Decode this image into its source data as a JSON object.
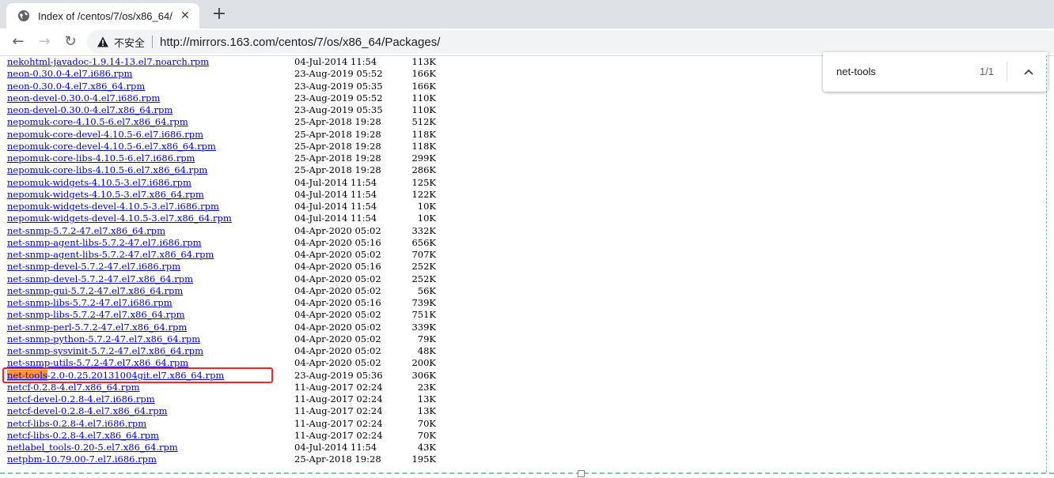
{
  "browser": {
    "tab_title": "Index of /centos/7/os/x86_64/",
    "tab_close": "✕",
    "new_tab": "+",
    "back": "←",
    "forward": "→",
    "reload": "↻",
    "security_label": "不安全",
    "url": "http://mirrors.163.com/centos/7/os/x86_64/Packages/"
  },
  "find_bar": {
    "query": "net-tools",
    "count": "1/1"
  },
  "listing": [
    {
      "name": "nekohtml-javadoc-1.9.14-13.el7.noarch.rpm",
      "date": "04-Jul-2014 11:54",
      "size": "113K"
    },
    {
      "name": "neon-0.30.0-4.el7.i686.rpm",
      "date": "23-Aug-2019 05:52",
      "size": "166K"
    },
    {
      "name": "neon-0.30.0-4.el7.x86_64.rpm",
      "date": "23-Aug-2019 05:35",
      "size": "166K"
    },
    {
      "name": "neon-devel-0.30.0-4.el7.i686.rpm",
      "date": "23-Aug-2019 05:52",
      "size": "110K"
    },
    {
      "name": "neon-devel-0.30.0-4.el7.x86_64.rpm",
      "date": "23-Aug-2019 05:35",
      "size": "110K"
    },
    {
      "name": "nepomuk-core-4.10.5-6.el7.x86_64.rpm",
      "date": "25-Apr-2018 19:28",
      "size": "512K"
    },
    {
      "name": "nepomuk-core-devel-4.10.5-6.el7.i686.rpm",
      "date": "25-Apr-2018 19:28",
      "size": "118K"
    },
    {
      "name": "nepomuk-core-devel-4.10.5-6.el7.x86_64.rpm",
      "date": "25-Apr-2018 19:28",
      "size": "118K"
    },
    {
      "name": "nepomuk-core-libs-4.10.5-6.el7.i686.rpm",
      "date": "25-Apr-2018 19:28",
      "size": "299K"
    },
    {
      "name": "nepomuk-core-libs-4.10.5-6.el7.x86_64.rpm",
      "date": "25-Apr-2018 19:28",
      "size": "286K"
    },
    {
      "name": "nepomuk-widgets-4.10.5-3.el7.i686.rpm",
      "date": "04-Jul-2014 11:54",
      "size": "125K"
    },
    {
      "name": "nepomuk-widgets-4.10.5-3.el7.x86_64.rpm",
      "date": "04-Jul-2014 11:54",
      "size": "122K"
    },
    {
      "name": "nepomuk-widgets-devel-4.10.5-3.el7.i686.rpm",
      "date": "04-Jul-2014 11:54",
      "size": "10K"
    },
    {
      "name": "nepomuk-widgets-devel-4.10.5-3.el7.x86_64.rpm",
      "date": "04-Jul-2014 11:54",
      "size": "10K"
    },
    {
      "name": "net-snmp-5.7.2-47.el7.x86_64.rpm",
      "date": "04-Apr-2020 05:02",
      "size": "332K"
    },
    {
      "name": "net-snmp-agent-libs-5.7.2-47.el7.i686.rpm",
      "date": "04-Apr-2020 05:16",
      "size": "656K"
    },
    {
      "name": "net-snmp-agent-libs-5.7.2-47.el7.x86_64.rpm",
      "date": "04-Apr-2020 05:02",
      "size": "707K"
    },
    {
      "name": "net-snmp-devel-5.7.2-47.el7.i686.rpm",
      "date": "04-Apr-2020 05:16",
      "size": "252K"
    },
    {
      "name": "net-snmp-devel-5.7.2-47.el7.x86_64.rpm",
      "date": "04-Apr-2020 05:02",
      "size": "252K"
    },
    {
      "name": "net-snmp-gui-5.7.2-47.el7.x86_64.rpm",
      "date": "04-Apr-2020 05:02",
      "size": "56K"
    },
    {
      "name": "net-snmp-libs-5.7.2-47.el7.i686.rpm",
      "date": "04-Apr-2020 05:16",
      "size": "739K"
    },
    {
      "name": "net-snmp-libs-5.7.2-47.el7.x86_64.rpm",
      "date": "04-Apr-2020 05:02",
      "size": "751K"
    },
    {
      "name": "net-snmp-perl-5.7.2-47.el7.x86_64.rpm",
      "date": "04-Apr-2020 05:02",
      "size": "339K"
    },
    {
      "name": "net-snmp-python-5.7.2-47.el7.x86_64.rpm",
      "date": "04-Apr-2020 05:02",
      "size": "79K"
    },
    {
      "name": "net-snmp-sysvinit-5.7.2-47.el7.x86_64.rpm",
      "date": "04-Apr-2020 05:02",
      "size": "48K"
    },
    {
      "name": "net-snmp-utils-5.7.2-47.el7.x86_64.rpm",
      "date": "04-Apr-2020 05:02",
      "size": "200K"
    },
    {
      "name": "net-tools-2.0-0.25.20131004git.el7.x86_64.rpm",
      "date": "23-Aug-2019 05:36",
      "size": "306K",
      "match": "net-tools"
    },
    {
      "name": "netcf-0.2.8-4.el7.x86_64.rpm",
      "date": "11-Aug-2017 02:24",
      "size": "23K"
    },
    {
      "name": "netcf-devel-0.2.8-4.el7.i686.rpm",
      "date": "11-Aug-2017 02:24",
      "size": "13K"
    },
    {
      "name": "netcf-devel-0.2.8-4.el7.x86_64.rpm",
      "date": "11-Aug-2017 02:24",
      "size": "13K"
    },
    {
      "name": "netcf-libs-0.2.8-4.el7.i686.rpm",
      "date": "11-Aug-2017 02:24",
      "size": "70K"
    },
    {
      "name": "netcf-libs-0.2.8-4.el7.x86_64.rpm",
      "date": "11-Aug-2017 02:24",
      "size": "70K"
    },
    {
      "name": "netlabel_tools-0.20-5.el7.x86_64.rpm",
      "date": "04-Jul-2014 11:54",
      "size": "43K"
    },
    {
      "name": "netpbm-10.79.00-7.el7.i686.rpm",
      "date": "25-Apr-2018 19:28",
      "size": "195K"
    }
  ],
  "colors": {
    "link": "#0000ee",
    "find_highlight": "#ff9632",
    "annotation_box": "#ff2020"
  },
  "icons": {
    "tab_favicon": "globe-icon",
    "security": "warning-triangle-icon",
    "find_prev": "chevron-up-icon"
  }
}
